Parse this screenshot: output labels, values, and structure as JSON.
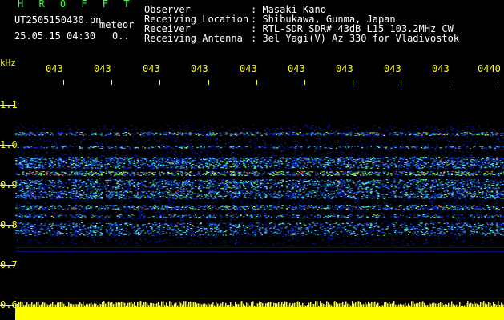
{
  "header": {
    "app_title": "H R O F F T",
    "filename": "UT2505150430.pn",
    "meteor_label": "meteor",
    "datetime": "25.05.15 04:30",
    "count": "0..",
    "meta": [
      {
        "label": "Observer",
        "value": ": Masaki Kano"
      },
      {
        "label": "Receiving Location",
        "value": ": Shibukawa, Gunma, Japan"
      },
      {
        "label": "Receiver",
        "value": ": RTL-SDR SDR# 43dB L15 103.2MHz CW"
      },
      {
        "label": "Receiving Antenna",
        "value": ": 3el Yagi(V) Az 330 for Vladivostok"
      }
    ]
  },
  "axis": {
    "unit": "kHz",
    "y_labels": [
      "1.1",
      "1.0",
      "0.9",
      "0.8",
      "0.7",
      "0.6"
    ],
    "x_labels": [
      "043",
      "043",
      "043",
      "043",
      "043",
      "043",
      "043",
      "043",
      "043",
      "0440"
    ]
  },
  "colors": {
    "header_green": "#3cff3c",
    "axis_yellow": "#ffff00",
    "background": "#000000"
  }
}
